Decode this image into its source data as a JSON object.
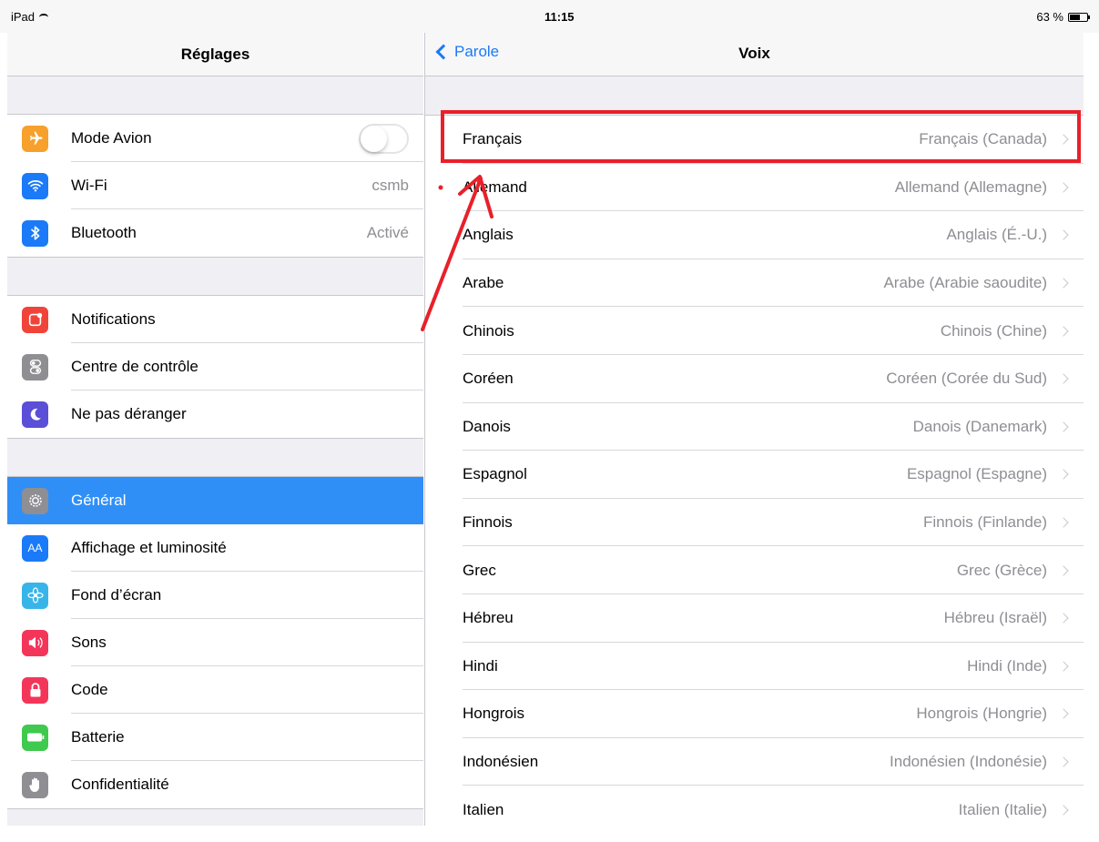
{
  "statusbar": {
    "device": "iPad",
    "time": "11:15",
    "battery": "63 %",
    "battery_level": 0.63
  },
  "settings": {
    "title": "Réglages",
    "groups": [
      [
        {
          "label": "Mode Avion",
          "icon": "airplane-icon",
          "color": "#f7a02b",
          "toggle": false
        },
        {
          "label": "Wi-Fi",
          "icon": "wifi-icon",
          "color": "#1a7af8",
          "value": "csmb"
        },
        {
          "label": "Bluetooth",
          "icon": "bluetooth-icon",
          "color": "#1a7af8",
          "value": "Activé"
        }
      ],
      [
        {
          "label": "Notifications",
          "icon": "notifications-icon",
          "color": "#f0443a"
        },
        {
          "label": "Centre de contrôle",
          "icon": "control-center-icon",
          "color": "#8e8e93"
        },
        {
          "label": "Ne pas déranger",
          "icon": "moon-icon",
          "color": "#5a4fd6"
        }
      ],
      [
        {
          "label": "Général",
          "icon": "gear-icon",
          "color": "#8e8e93",
          "selected": true
        },
        {
          "label": "Affichage et luminosité",
          "icon": "text-size-icon",
          "color": "#1a7af8"
        },
        {
          "label": "Fond d’écran",
          "icon": "wallpaper-icon",
          "color": "#38b5e8"
        },
        {
          "label": "Sons",
          "icon": "speaker-icon",
          "color": "#f4355a"
        },
        {
          "label": "Code",
          "icon": "lock-icon",
          "color": "#f4355a"
        },
        {
          "label": "Batterie",
          "icon": "battery-icon",
          "color": "#3fc94f"
        },
        {
          "label": "Confidentialité",
          "icon": "hand-icon",
          "color": "#8e8e93"
        }
      ]
    ]
  },
  "voices": {
    "back_label": "Parole",
    "title": "Voix",
    "items": [
      {
        "label": "Français",
        "value": "Français (Canada)"
      },
      {
        "label": "Allemand",
        "value": "Allemand (Allemagne)"
      },
      {
        "label": "Anglais",
        "value": "Anglais (É.-U.)"
      },
      {
        "label": "Arabe",
        "value": "Arabe (Arabie saoudite)"
      },
      {
        "label": "Chinois",
        "value": "Chinois (Chine)"
      },
      {
        "label": "Coréen",
        "value": "Coréen (Corée du Sud)"
      },
      {
        "label": "Danois",
        "value": "Danois (Danemark)"
      },
      {
        "label": "Espagnol",
        "value": "Espagnol (Espagne)"
      },
      {
        "label": "Finnois",
        "value": "Finnois (Finlande)"
      },
      {
        "label": "Grec",
        "value": "Grec (Grèce)"
      },
      {
        "label": "Hébreu",
        "value": "Hébreu (Israël)"
      },
      {
        "label": "Hindi",
        "value": "Hindi (Inde)"
      },
      {
        "label": "Hongrois",
        "value": "Hongrois (Hongrie)"
      },
      {
        "label": "Indonésien",
        "value": "Indonésien (Indonésie)"
      },
      {
        "label": "Italien",
        "value": "Italien (Italie)"
      }
    ]
  },
  "annotation": {
    "color": "#e8202a"
  }
}
